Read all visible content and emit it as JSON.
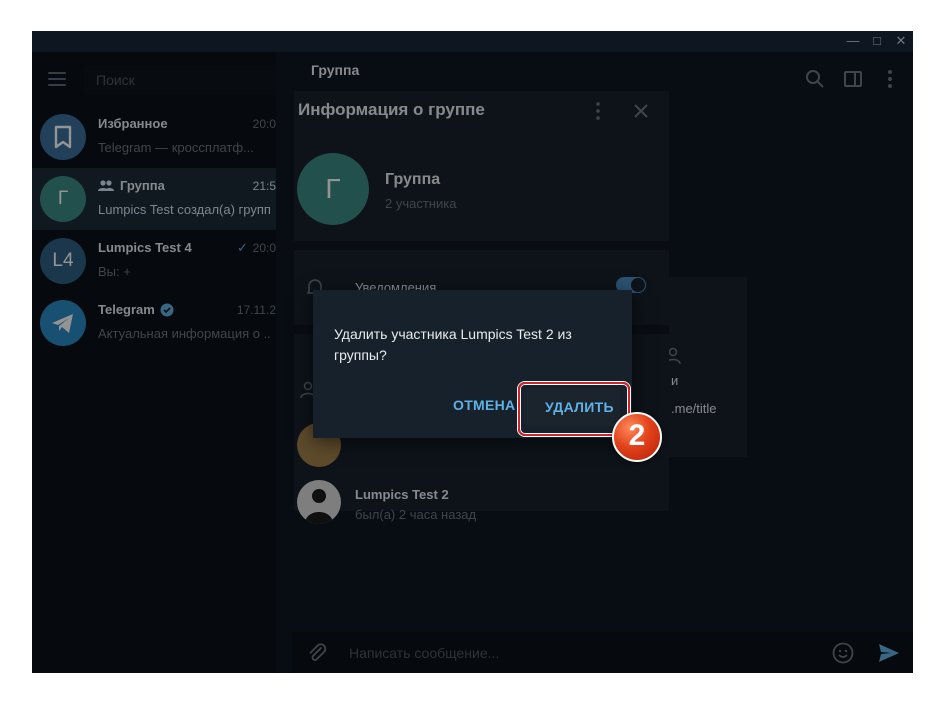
{
  "left": {
    "search_placeholder": "Поиск",
    "chats": [
      {
        "name": "Избранное",
        "time": "20:0",
        "message": "Telegram — кроссплатф...",
        "avatar": "",
        "avatar_color": "#3b6f9a",
        "icon": "bookmark-icon"
      },
      {
        "name": "Группа",
        "time": "21:5",
        "message": "Lumpics Test создал(а) групп",
        "avatar": "Г",
        "avatar_color": "#3b8b83",
        "icon": "group-icon"
      },
      {
        "name": "Lumpics Test 4",
        "time": "20:0",
        "message": "Вы: +",
        "avatar": "L4",
        "avatar_color": "#2f5f83",
        "icon": "check-icon"
      },
      {
        "name": "Telegram",
        "time": "17.11.2",
        "message": "Актуальная информация о ...",
        "avatar": "",
        "avatar_color": "#2a8ac5",
        "icon": "verified-icon"
      }
    ]
  },
  "chat": {
    "title": "Группа",
    "composer_placeholder": "Написать сообщение..."
  },
  "info": {
    "title": "Информация о группе",
    "avatar_letter": "Г",
    "group_name": "Группа",
    "members_count": "2 участника",
    "notifications_label": "Уведомления",
    "members": [
      {
        "name": "Lumpics Test 2",
        "status": "был(а) 2 часа назад"
      }
    ]
  },
  "background_card": {
    "line1": "и",
    "line2": ".me/title"
  },
  "dialog": {
    "message": "Удалить участника Lumpics Test 2 из группы?",
    "cancel_label": "ОТМЕНА",
    "delete_label": "УДАЛИТЬ"
  },
  "annotation": {
    "step_number": "2"
  },
  "colors": {
    "window_bg": "#0e1621",
    "panel_bg": "#17212b",
    "accent": "#5fb1e6",
    "highlight_red": "#d0242c"
  }
}
